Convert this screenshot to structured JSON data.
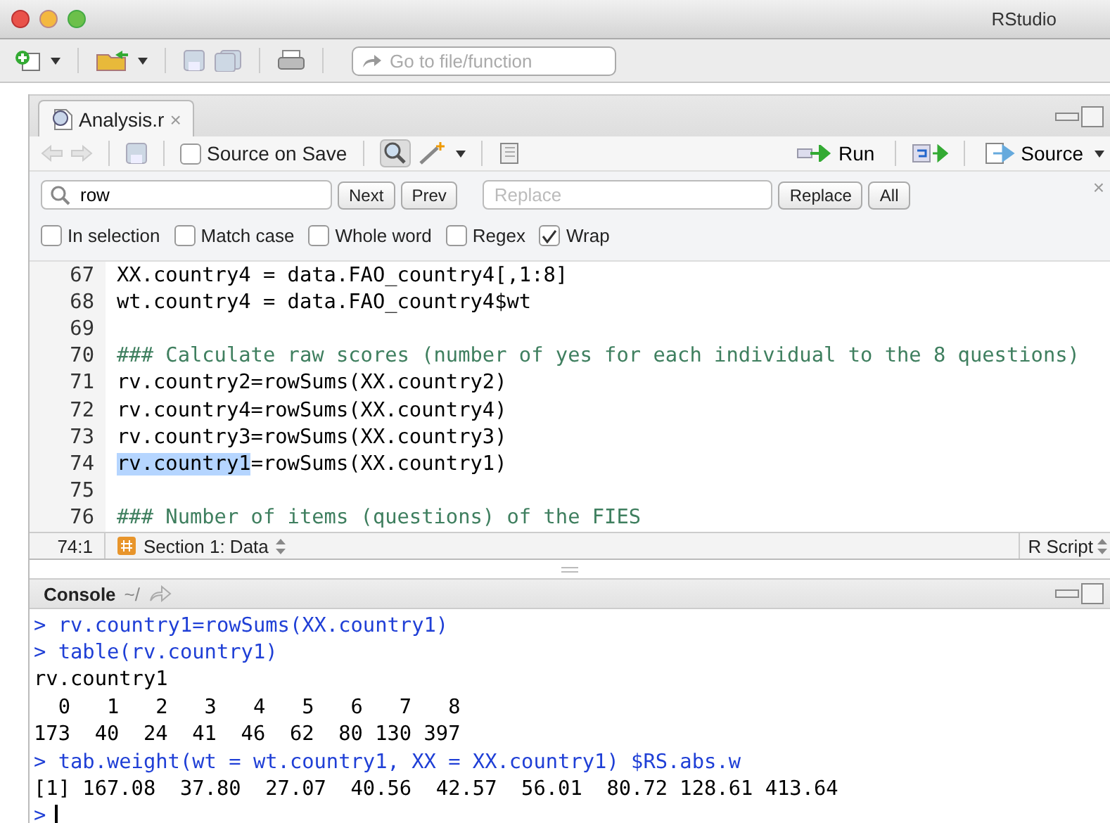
{
  "window": {
    "title": "RStudio"
  },
  "toolbar": {
    "goto_placeholder": "Go to file/function"
  },
  "editor": {
    "tabs": [
      {
        "label": "Analysis.r",
        "close": "×",
        "selected": true
      }
    ],
    "toolbar": {
      "source_on_save": {
        "label": "Source on Save",
        "checked": false
      },
      "run": "Run",
      "source": "Source"
    },
    "find": {
      "query": "row",
      "next": "Next",
      "prev": "Prev",
      "replace_placeholder": "Replace",
      "replace": "Replace",
      "all": "All",
      "close": "×",
      "options": [
        {
          "label": "In selection",
          "checked": false
        },
        {
          "label": "Match case",
          "checked": false
        },
        {
          "label": "Whole word",
          "checked": false
        },
        {
          "label": "Regex",
          "checked": false
        },
        {
          "label": "Wrap",
          "checked": true
        }
      ]
    },
    "lines": [
      {
        "number": "67",
        "kind": "code",
        "segments": [
          {
            "text": "XX.country4 = data.FAO_country4[,1:8]",
            "selected": false
          }
        ]
      },
      {
        "number": "68",
        "kind": "code",
        "segments": [
          {
            "text": "wt.country4 = data.FAO_country4$wt",
            "selected": false
          }
        ]
      },
      {
        "number": "69",
        "kind": "blank"
      },
      {
        "number": "70",
        "kind": "comment",
        "segments": [
          {
            "text": "### Calculate raw scores (number of yes for each individual to the 8 questions)",
            "selected": false
          }
        ]
      },
      {
        "number": "71",
        "kind": "code",
        "segments": [
          {
            "text": "rv.country2=rowSums(XX.country2)",
            "selected": false
          }
        ]
      },
      {
        "number": "72",
        "kind": "code",
        "segments": [
          {
            "text": "rv.country4=rowSums(XX.country4)",
            "selected": false
          }
        ]
      },
      {
        "number": "73",
        "kind": "code",
        "segments": [
          {
            "text": "rv.country3=rowSums(XX.country3)",
            "selected": false
          }
        ]
      },
      {
        "number": "74",
        "kind": "code",
        "segments": [
          {
            "text": "rv.country1",
            "selected": true
          },
          {
            "text": "=rowSums(XX.country1)",
            "selected": false
          }
        ]
      },
      {
        "number": "75",
        "kind": "blank"
      },
      {
        "number": "76",
        "kind": "comment",
        "segments": [
          {
            "text": "### Number of items (questions) of the FIES",
            "selected": false
          }
        ]
      }
    ],
    "status": {
      "position": "74:1",
      "section": "Section 1: Data",
      "file_type": "R Script"
    }
  },
  "console": {
    "title": "Console",
    "path": "~/",
    "lines": [
      {
        "kind": "input",
        "text": "> rv.country1=rowSums(XX.country1)"
      },
      {
        "kind": "input",
        "text": "> table(rv.country1)"
      },
      {
        "kind": "output",
        "text": "rv.country1"
      },
      {
        "kind": "output",
        "text": "  0   1   2   3   4   5   6   7   8 "
      },
      {
        "kind": "output",
        "text": "173  40  24  41  46  62  80 130 397 "
      },
      {
        "kind": "input",
        "text": "> tab.weight(wt = wt.country1, XX = XX.country1) $RS.abs.w"
      },
      {
        "kind": "output",
        "text": "[1] 167.08  37.80  27.07  40.56  42.57  56.01  80.72 128.61 413.64"
      },
      {
        "kind": "prompt",
        "text": ">"
      }
    ]
  }
}
